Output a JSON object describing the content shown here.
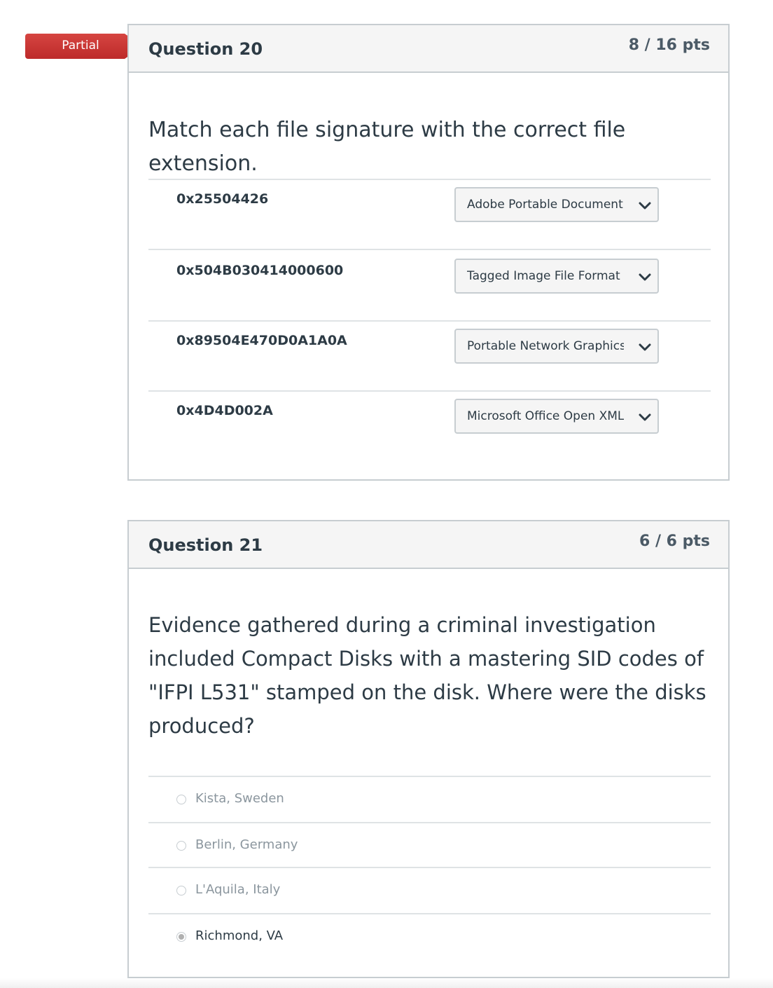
{
  "q20": {
    "badge": "Partial",
    "title": "Question 20",
    "points": "8 / 16 pts",
    "prompt": "Match each file signature with the correct file extension.",
    "rows": [
      {
        "signature": "0x25504426",
        "selected": "Adobe Portable Document Format"
      },
      {
        "signature": "0x504B030414000600",
        "selected": "Tagged Image File Format"
      },
      {
        "signature": "0x89504E470D0A1A0A",
        "selected": "Portable Network Graphics"
      },
      {
        "signature": "0x4D4D002A",
        "selected": "Microsoft Office Open XML Format"
      }
    ]
  },
  "q21": {
    "title": "Question 21",
    "points": "6 / 6 pts",
    "prompt_lines": [
      "Evidence gathered during a criminal investigation",
      "included Compact Disks with a mastering SID codes of",
      "\"IFPI L531\" stamped on the disk. Where were the disks",
      "produced?"
    ],
    "options": [
      {
        "label": "Kista, Sweden",
        "selected": false
      },
      {
        "label": "Berlin, Germany",
        "selected": false
      },
      {
        "label": "L'Aquila, Italy",
        "selected": false
      },
      {
        "label": "Richmond, VA",
        "selected": true
      }
    ]
  }
}
